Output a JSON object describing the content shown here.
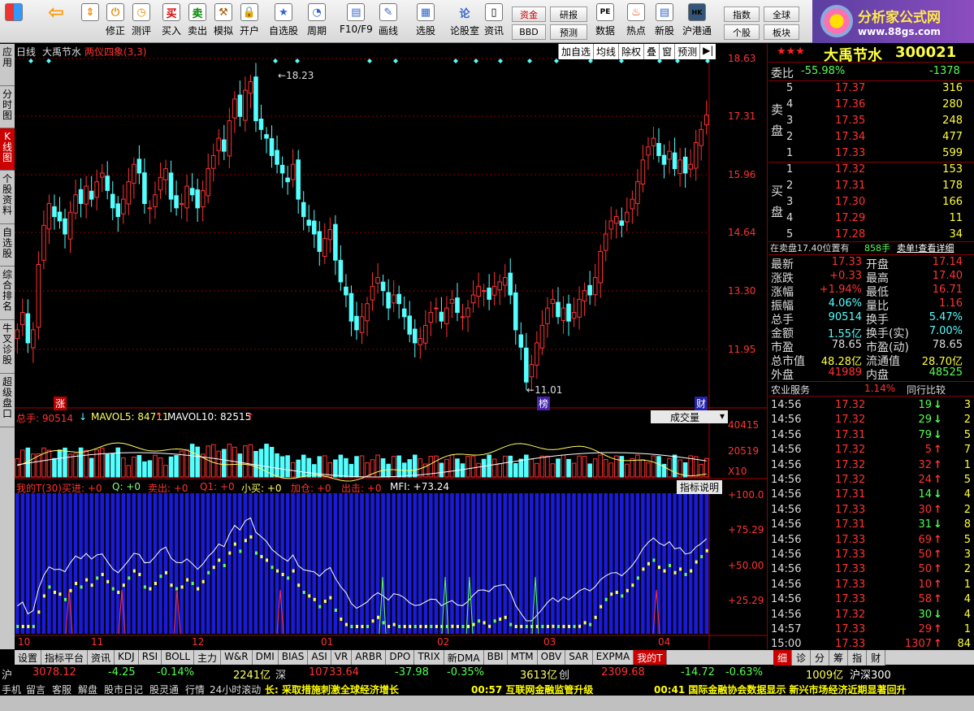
{
  "toolbar": {
    "buttons": [
      "修正",
      "测评",
      "买入",
      "卖出",
      "模拟",
      "开户",
      "自选股",
      "周期",
      "F10/F9",
      "画线",
      "选股",
      "论股室",
      "资讯",
      "数据",
      "热点",
      "新股",
      "沪港通"
    ],
    "small": [
      "资金",
      "BBD",
      "研报",
      "预测",
      "指数",
      "个股",
      "全球",
      "板块"
    ]
  },
  "logo": {
    "line1": "分析家公式网",
    "line2": "www.88gs.com"
  },
  "left_tabs": [
    "应用",
    "分时图",
    "K线图",
    "个股资料",
    "自选股",
    "综合排名",
    "牛叉诊股",
    "超级盘口"
  ],
  "kline": {
    "period": "日线",
    "name": "大禹节水",
    "formula": "两仪四象(3,3)",
    "high_mark": "18.23",
    "low_mark": "11.01",
    "tools": [
      "加自选",
      "均线",
      "除权",
      "叠",
      "窗",
      "预测"
    ],
    "price_axis": [
      "18.63",
      "17.31",
      "15.96",
      "14.64",
      "13.30",
      "11.95"
    ],
    "tag_zhang": "涨",
    "tag_bang": "榜",
    "tag_cai": "财"
  },
  "volume": {
    "label": "总手: 90514",
    "mavol5": "MAVOL5: 84711",
    "mavol10": "MAVOL10: 82515",
    "selector": "成交量",
    "axis": [
      "40415",
      "20519",
      "X10"
    ]
  },
  "indicator": {
    "title": "我的T(30)",
    "buy": "买进: +0",
    "q": "Q: +0",
    "sell": "卖出: +0",
    "q1": "Q1: +0",
    "small_buy": "小买: +0",
    "add": "加仓: +0",
    "out": "出击: +0",
    "mfi": "MFI: +73.24",
    "explain": "指标说明",
    "axis": [
      "+100.0",
      "+75.29",
      "+50.00",
      "+25.29"
    ]
  },
  "months": [
    "10",
    "11",
    "12",
    "01",
    "02",
    "03",
    "04"
  ],
  "quote": {
    "stars": "★★★",
    "name": "大禹节水",
    "code": "300021",
    "wb_label": "委比",
    "wb": "-55.98%",
    "wc": "-1378",
    "sell_label": "卖盘",
    "buy_label": "买盘",
    "asks": [
      [
        "5",
        "17.37",
        "316"
      ],
      [
        "4",
        "17.36",
        "280"
      ],
      [
        "3",
        "17.35",
        "248"
      ],
      [
        "2",
        "17.34",
        "477"
      ],
      [
        "1",
        "17.33",
        "599"
      ]
    ],
    "bids": [
      [
        "1",
        "17.32",
        "153"
      ],
      [
        "2",
        "17.31",
        "178"
      ],
      [
        "3",
        "17.30",
        "166"
      ],
      [
        "4",
        "17.29",
        "11"
      ],
      [
        "5",
        "17.28",
        "34"
      ]
    ],
    "note1": "在卖盘17.40位置有",
    "note2": "858手",
    "note3": "卖单!查看详细",
    "stats": [
      [
        "最新",
        "17.33",
        "开盘",
        "17.14"
      ],
      [
        "涨跌",
        "+0.33",
        "最高",
        "17.40"
      ],
      [
        "涨幅",
        "+1.94%",
        "最低",
        "16.71"
      ],
      [
        "振幅",
        "4.06%",
        "量比",
        "1.16"
      ],
      [
        "总手",
        "90514",
        "换手",
        "5.47%"
      ],
      [
        "金额",
        "1.55亿",
        "换手(实)",
        "7.00%"
      ],
      [
        "市盈",
        "78.65",
        "市盈(动)",
        "78.65"
      ],
      [
        "总市值",
        "48.28亿",
        "流通值",
        "28.70亿"
      ],
      [
        "外盘",
        "41989",
        "内盘",
        "48525"
      ]
    ],
    "sector": "农业服务",
    "sector_pct": "1.14%",
    "compare": "同行比较",
    "ticks": [
      [
        "14:56",
        "17.32",
        "19",
        "↓"
      ],
      [
        "14:56",
        "17.32",
        "29",
        "↓"
      ],
      [
        "14:56",
        "17.31",
        "79",
        "↓"
      ],
      [
        "14:56",
        "17.32",
        "5",
        "↑"
      ],
      [
        "14:56",
        "17.32",
        "32",
        "↑"
      ],
      [
        "14:56",
        "17.32",
        "24",
        "↑"
      ],
      [
        "14:56",
        "17.31",
        "14",
        "↓"
      ],
      [
        "14:56",
        "17.33",
        "30",
        "↑"
      ],
      [
        "14:56",
        "17.31",
        "31",
        "↓"
      ],
      [
        "14:56",
        "17.33",
        "69",
        "↑"
      ],
      [
        "14:56",
        "17.33",
        "50",
        "↑"
      ],
      [
        "14:56",
        "17.33",
        "50",
        "↑"
      ],
      [
        "14:56",
        "17.33",
        "10",
        "↑"
      ],
      [
        "14:56",
        "17.33",
        "58",
        "↑"
      ],
      [
        "14:56",
        "17.32",
        "30",
        "↓"
      ],
      [
        "14:57",
        "17.33",
        "29",
        "↑"
      ],
      [
        "15:00",
        "17.33",
        "1307",
        "↑"
      ]
    ],
    "tick_side": [
      "3",
      "2",
      "5",
      "7",
      "1",
      "5",
      "4",
      "2",
      "8",
      "5",
      "3",
      "2",
      "1",
      "4",
      "4",
      "1",
      "84"
    ]
  },
  "bottom_tabs": [
    "设置",
    "指标平台",
    "资讯",
    "KDJ",
    "RSI",
    "BOLL",
    "主力",
    "W&R",
    "DMI",
    "BIAS",
    "ASI",
    "VR",
    "ARBR",
    "DPO",
    "TRIX",
    "新DMA",
    "BBI",
    "MTM",
    "OBV",
    "SAR",
    "EXPMA",
    "我的T"
  ],
  "right_tabs": [
    "细",
    "诊",
    "分",
    "筹",
    "指",
    "财"
  ],
  "index_bar": {
    "sh": "沪",
    "sh_v": "3078.12",
    "sh_c": "-4.25",
    "sh_p": "-0.14%",
    "sh_a": "2241亿",
    "sz": "深",
    "sz_v": "10733.64",
    "sz_c": "-37.98",
    "sz_p": "-0.35%",
    "sz_a": "3613亿",
    "cy": "创",
    "cy_v": "2309.68",
    "cy_c": "-14.72",
    "cy_p": "-0.63%",
    "cy_a": "1009亿",
    "hs": "沪深300"
  },
  "news_bar": {
    "items": [
      "手机",
      "留言",
      "客服",
      "解盘",
      "股市日记",
      "股灵通",
      "行情",
      "24小时滚动"
    ],
    "n1": "长: 采取措施刺激全球经济增长",
    "n2": "00:57 互联网金融监管升级",
    "n3": "00:41 国际金融协会数据显示 新兴市场经济近期显著回升"
  },
  "colors": {
    "up": "#ff3232",
    "down": "#54ffff",
    "bg": "#000000",
    "blue": "#1a1ad8"
  }
}
